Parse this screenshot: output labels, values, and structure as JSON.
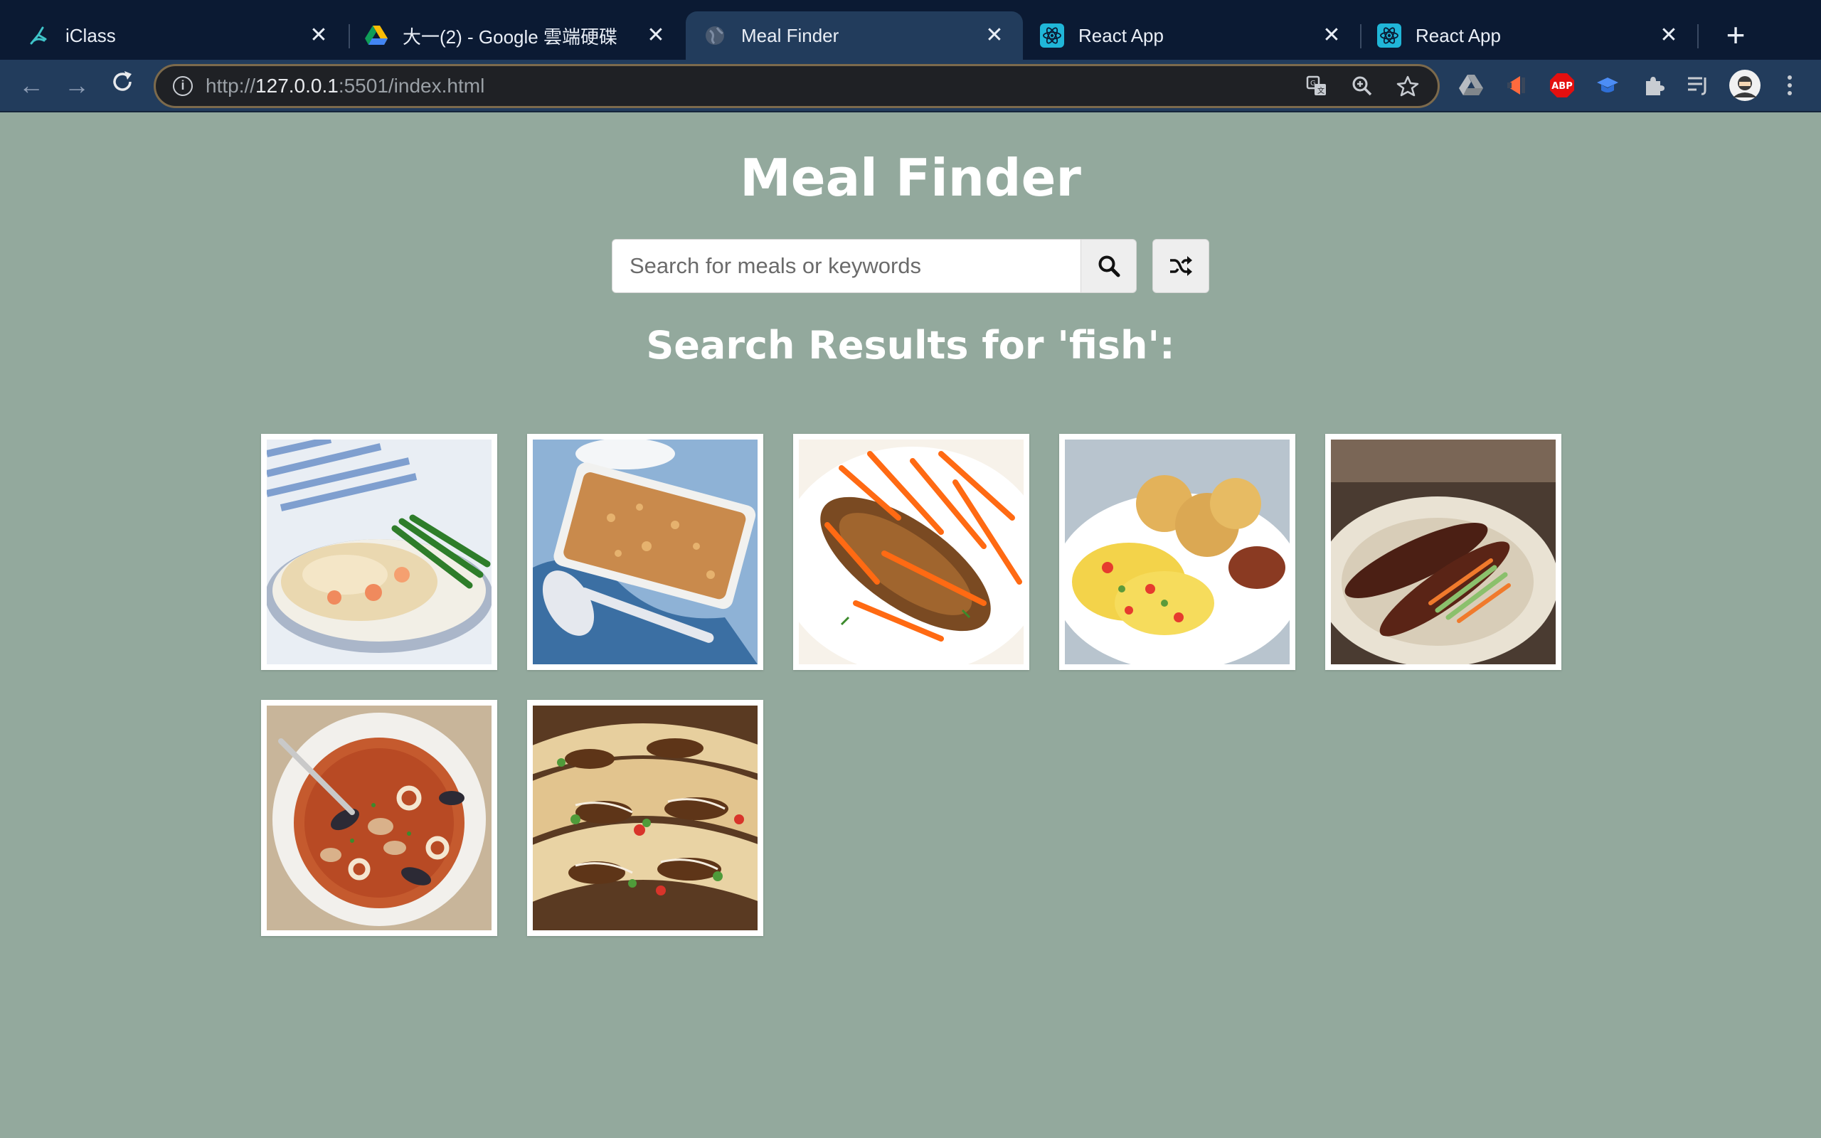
{
  "browser": {
    "tabs": [
      {
        "title": "iClass",
        "favicon": "iclass-icon",
        "active": false
      },
      {
        "title": "大一(2) - Google 雲端硬碟",
        "favicon": "google-drive-icon",
        "active": false
      },
      {
        "title": "Meal Finder",
        "favicon": "globe-icon",
        "active": true
      },
      {
        "title": "React App",
        "favicon": "react-icon",
        "active": false
      },
      {
        "title": "React App",
        "favicon": "react-icon",
        "active": false
      }
    ],
    "url": {
      "scheme": "http://",
      "host": "127.0.0.1",
      "rest": ":5501/index.html"
    }
  },
  "page": {
    "title": "Meal Finder",
    "search": {
      "placeholder": "Search for meals or keywords",
      "value": ""
    },
    "results_heading": "Search Results for 'fish':",
    "meals": [
      {
        "name": "meal-1",
        "depiction": "fish pie with green beans"
      },
      {
        "name": "meal-2",
        "depiction": "baked fish gratin"
      },
      {
        "name": "meal-3",
        "depiction": "whole fried fish with carrots"
      },
      {
        "name": "meal-4",
        "depiction": "ackee and saltfish with dumplings"
      },
      {
        "name": "meal-5",
        "depiction": "grilled fish with vegetables"
      },
      {
        "name": "meal-6",
        "depiction": "seafood soup"
      },
      {
        "name": "meal-7",
        "depiction": "fish tacos"
      }
    ]
  },
  "colors": {
    "page_bg": "#93a99d",
    "tabstrip_bg": "#0b1a33",
    "toolbar_bg": "#223c5c"
  }
}
